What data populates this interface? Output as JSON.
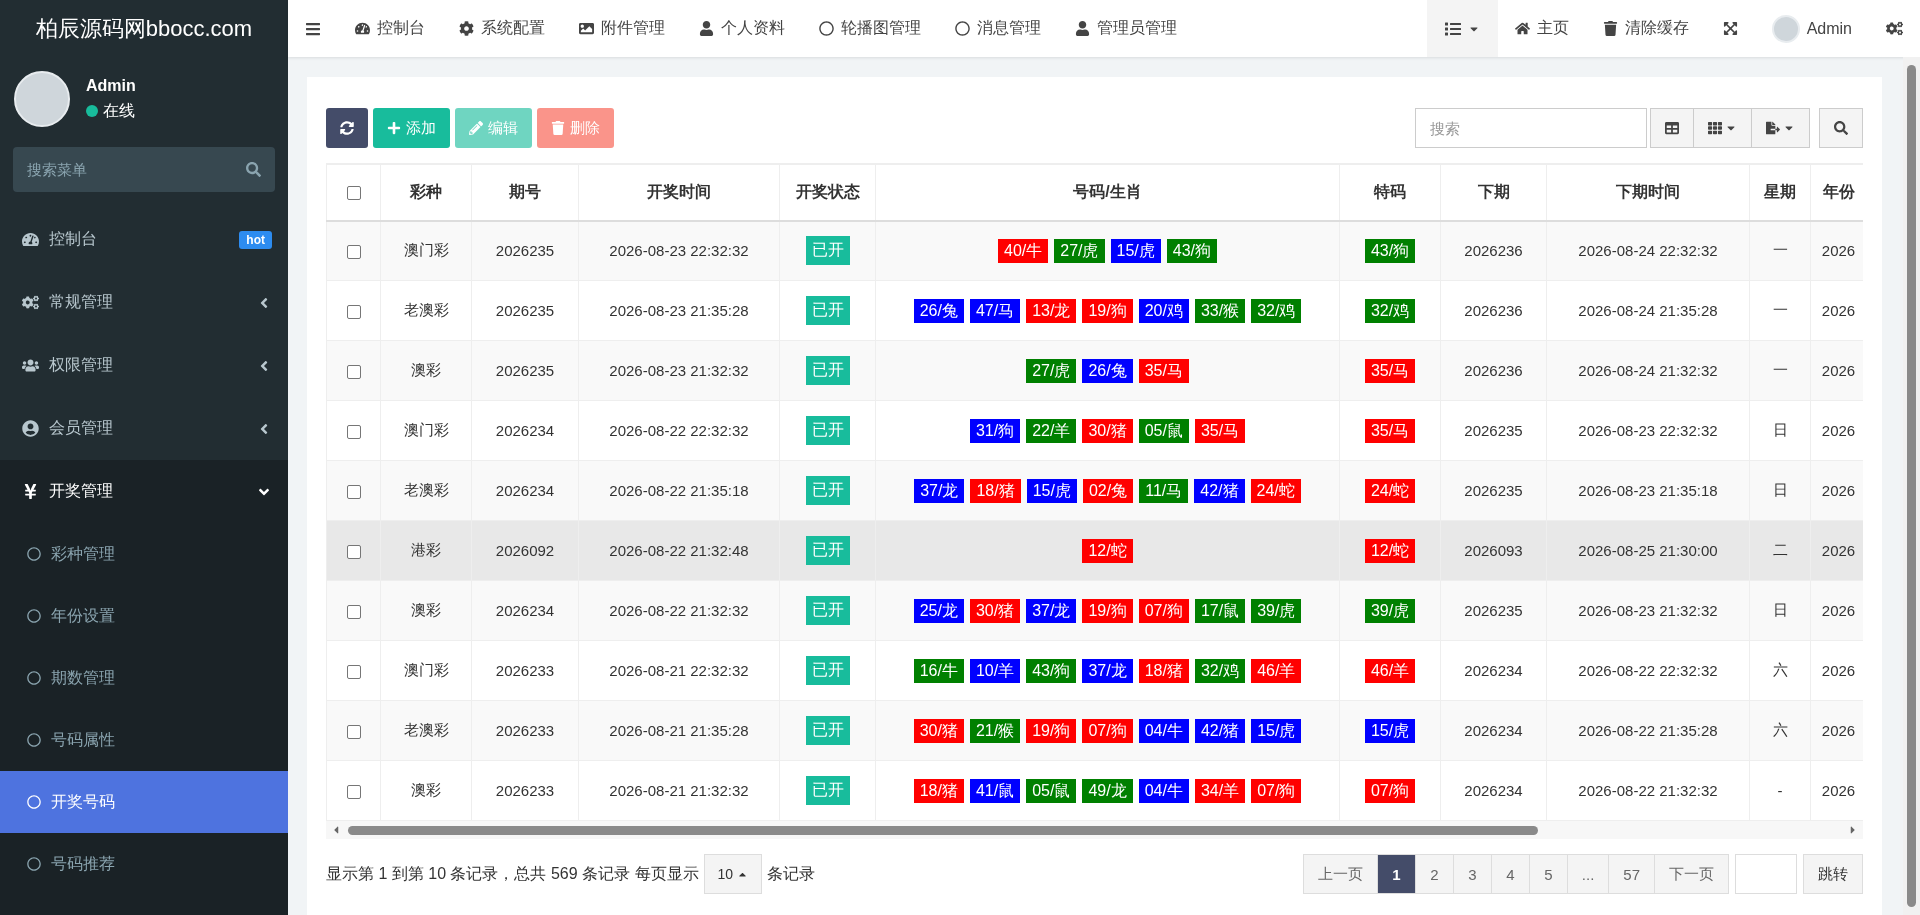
{
  "sidebar": {
    "logo": "柏辰源码网bbocc.com",
    "user": {
      "name": "Admin",
      "status": "在线"
    },
    "search": {
      "placeholder": "搜索菜单"
    },
    "items": [
      {
        "label": "控制台",
        "badge": "hot"
      },
      {
        "label": "常规管理",
        "expanded": false
      },
      {
        "label": "权限管理",
        "expanded": false
      },
      {
        "label": "会员管理",
        "expanded": false
      },
      {
        "label": "开奖管理",
        "expanded": true,
        "children": [
          {
            "label": "彩种管理",
            "selected": false
          },
          {
            "label": "年份设置",
            "selected": false
          },
          {
            "label": "期数管理",
            "selected": false
          },
          {
            "label": "号码属性",
            "selected": false
          },
          {
            "label": "开奖号码",
            "selected": true
          },
          {
            "label": "号码推荐",
            "selected": false
          }
        ]
      }
    ]
  },
  "top_nav": {
    "items": [
      "控制台",
      "系统配置",
      "附件管理",
      "个人资料",
      "轮播图管理",
      "消息管理",
      "管理员管理"
    ],
    "right_items": [
      "主页",
      "清除缓存"
    ],
    "user": "Admin"
  },
  "toolbar": {
    "buttons": [
      {
        "kind": "refresh",
        "disabled": false
      },
      {
        "kind": "add",
        "label": "添加",
        "disabled": false
      },
      {
        "kind": "edit",
        "label": "编辑",
        "disabled": true
      },
      {
        "kind": "delete",
        "label": "删除",
        "disabled": true
      }
    ],
    "search": {
      "placeholder": "搜索"
    }
  },
  "table": {
    "header_checked": false,
    "columns": [
      "彩种",
      "期号",
      "开奖时间",
      "开奖状态",
      "号码/生肖",
      "特码",
      "下期",
      "下期时间",
      "星期",
      "年份"
    ],
    "rows": [
      {
        "checked": false,
        "highlighted": false,
        "lottery": "澳门彩",
        "issue": "2026235",
        "draw_time": "2026-08-23 22:32:32",
        "status": "已开",
        "numbers": [
          {
            "text": "40/牛",
            "color": "#ff0000"
          },
          {
            "text": "27/虎",
            "color": "#008000"
          },
          {
            "text": "15/虎",
            "color": "#0000ff"
          },
          {
            "text": "43/狗",
            "color": "#008000"
          }
        ],
        "special": {
          "text": "43/狗",
          "color": "#008000"
        },
        "next_issue": "2026236",
        "next_time": "2026-08-24 22:32:32",
        "weekday": "一",
        "year": "2026"
      },
      {
        "checked": false,
        "highlighted": false,
        "lottery": "老澳彩",
        "issue": "2026235",
        "draw_time": "2026-08-23 21:35:28",
        "status": "已开",
        "numbers": [
          {
            "text": "26/兔",
            "color": "#0000ff"
          },
          {
            "text": "47/马",
            "color": "#0000ff"
          },
          {
            "text": "13/龙",
            "color": "#ff0000"
          },
          {
            "text": "19/狗",
            "color": "#ff0000"
          },
          {
            "text": "20/鸡",
            "color": "#0000ff"
          },
          {
            "text": "33/猴",
            "color": "#008000"
          },
          {
            "text": "32/鸡",
            "color": "#008000"
          }
        ],
        "special": {
          "text": "32/鸡",
          "color": "#008000"
        },
        "next_issue": "2026236",
        "next_time": "2026-08-24 21:35:28",
        "weekday": "一",
        "year": "2026"
      },
      {
        "checked": false,
        "highlighted": false,
        "lottery": "澳彩",
        "issue": "2026235",
        "draw_time": "2026-08-23 21:32:32",
        "status": "已开",
        "numbers": [
          {
            "text": "27/虎",
            "color": "#008000"
          },
          {
            "text": "26/兔",
            "color": "#0000ff"
          },
          {
            "text": "35/马",
            "color": "#ff0000"
          }
        ],
        "special": {
          "text": "35/马",
          "color": "#ff0000"
        },
        "next_issue": "2026236",
        "next_time": "2026-08-24 21:32:32",
        "weekday": "一",
        "year": "2026"
      },
      {
        "checked": false,
        "highlighted": false,
        "lottery": "澳门彩",
        "issue": "2026234",
        "draw_time": "2026-08-22 22:32:32",
        "status": "已开",
        "numbers": [
          {
            "text": "31/狗",
            "color": "#0000ff"
          },
          {
            "text": "22/羊",
            "color": "#008000"
          },
          {
            "text": "30/猪",
            "color": "#ff0000"
          },
          {
            "text": "05/鼠",
            "color": "#008000"
          },
          {
            "text": "35/马",
            "color": "#ff0000"
          }
        ],
        "special": {
          "text": "35/马",
          "color": "#ff0000"
        },
        "next_issue": "2026235",
        "next_time": "2026-08-23 22:32:32",
        "weekday": "日",
        "year": "2026"
      },
      {
        "checked": false,
        "highlighted": false,
        "lottery": "老澳彩",
        "issue": "2026234",
        "draw_time": "2026-08-22 21:35:18",
        "status": "已开",
        "numbers": [
          {
            "text": "37/龙",
            "color": "#0000ff"
          },
          {
            "text": "18/猪",
            "color": "#ff0000"
          },
          {
            "text": "15/虎",
            "color": "#0000ff"
          },
          {
            "text": "02/兔",
            "color": "#ff0000"
          },
          {
            "text": "11/马",
            "color": "#008000"
          },
          {
            "text": "42/猪",
            "color": "#0000ff"
          },
          {
            "text": "24/蛇",
            "color": "#ff0000"
          }
        ],
        "special": {
          "text": "24/蛇",
          "color": "#ff0000"
        },
        "next_issue": "2026235",
        "next_time": "2026-08-23 21:35:18",
        "weekday": "日",
        "year": "2026"
      },
      {
        "checked": false,
        "highlighted": true,
        "lottery": "港彩",
        "issue": "2026092",
        "draw_time": "2026-08-22 21:32:48",
        "status": "已开",
        "numbers": [
          {
            "text": "12/蛇",
            "color": "#ff0000"
          }
        ],
        "special": {
          "text": "12/蛇",
          "color": "#ff0000"
        },
        "next_issue": "2026093",
        "next_time": "2026-08-25 21:30:00",
        "weekday": "二",
        "year": "2026"
      },
      {
        "checked": false,
        "highlighted": false,
        "lottery": "澳彩",
        "issue": "2026234",
        "draw_time": "2026-08-22 21:32:32",
        "status": "已开",
        "numbers": [
          {
            "text": "25/龙",
            "color": "#0000ff"
          },
          {
            "text": "30/猪",
            "color": "#ff0000"
          },
          {
            "text": "37/龙",
            "color": "#0000ff"
          },
          {
            "text": "19/狗",
            "color": "#ff0000"
          },
          {
            "text": "07/狗",
            "color": "#ff0000"
          },
          {
            "text": "17/鼠",
            "color": "#008000"
          },
          {
            "text": "39/虎",
            "color": "#008000"
          }
        ],
        "special": {
          "text": "39/虎",
          "color": "#008000"
        },
        "next_issue": "2026235",
        "next_time": "2026-08-23 21:32:32",
        "weekday": "日",
        "year": "2026"
      },
      {
        "checked": false,
        "highlighted": false,
        "lottery": "澳门彩",
        "issue": "2026233",
        "draw_time": "2026-08-21 22:32:32",
        "status": "已开",
        "numbers": [
          {
            "text": "16/牛",
            "color": "#008000"
          },
          {
            "text": "10/羊",
            "color": "#0000ff"
          },
          {
            "text": "43/狗",
            "color": "#008000"
          },
          {
            "text": "37/龙",
            "color": "#0000ff"
          },
          {
            "text": "18/猪",
            "color": "#ff0000"
          },
          {
            "text": "32/鸡",
            "color": "#008000"
          },
          {
            "text": "46/羊",
            "color": "#ff0000"
          }
        ],
        "special": {
          "text": "46/羊",
          "color": "#ff0000"
        },
        "next_issue": "2026234",
        "next_time": "2026-08-22 22:32:32",
        "weekday": "六",
        "year": "2026"
      },
      {
        "checked": false,
        "highlighted": false,
        "lottery": "老澳彩",
        "issue": "2026233",
        "draw_time": "2026-08-21 21:35:28",
        "status": "已开",
        "numbers": [
          {
            "text": "30/猪",
            "color": "#ff0000"
          },
          {
            "text": "21/猴",
            "color": "#008000"
          },
          {
            "text": "19/狗",
            "color": "#ff0000"
          },
          {
            "text": "07/狗",
            "color": "#ff0000"
          },
          {
            "text": "04/牛",
            "color": "#0000ff"
          },
          {
            "text": "42/猪",
            "color": "#0000ff"
          },
          {
            "text": "15/虎",
            "color": "#0000ff"
          }
        ],
        "special": {
          "text": "15/虎",
          "color": "#0000ff"
        },
        "next_issue": "2026234",
        "next_time": "2026-08-22 21:35:28",
        "weekday": "六",
        "year": "2026"
      },
      {
        "checked": false,
        "highlighted": false,
        "lottery": "澳彩",
        "issue": "2026233",
        "draw_time": "2026-08-21 21:32:32",
        "status": "已开",
        "numbers": [
          {
            "text": "18/猪",
            "color": "#ff0000"
          },
          {
            "text": "41/鼠",
            "color": "#0000ff"
          },
          {
            "text": "05/鼠",
            "color": "#008000"
          },
          {
            "text": "49/龙",
            "color": "#008000"
          },
          {
            "text": "04/牛",
            "color": "#0000ff"
          },
          {
            "text": "34/羊",
            "color": "#ff0000"
          },
          {
            "text": "07/狗",
            "color": "#ff0000"
          }
        ],
        "special": {
          "text": "07/狗",
          "color": "#ff0000"
        },
        "next_issue": "2026234",
        "next_time": "2026-08-22 21:32:32",
        "weekday": "-",
        "year": "2026"
      }
    ]
  },
  "footer": {
    "summary": "显示第 1 到第 10 条记录，总共 569 条记录 每页显示",
    "page_size": "10",
    "page_size_suffix": "条记录",
    "pages": [
      {
        "label": "上一页",
        "selected": false
      },
      {
        "label": "1",
        "selected": true
      },
      {
        "label": "2",
        "selected": false
      },
      {
        "label": "3",
        "selected": false
      },
      {
        "label": "4",
        "selected": false
      },
      {
        "label": "5",
        "selected": false
      },
      {
        "label": "...",
        "selected": false
      },
      {
        "label": "57",
        "selected": false
      },
      {
        "label": "下一页",
        "selected": false
      }
    ],
    "jump": "跳转"
  }
}
